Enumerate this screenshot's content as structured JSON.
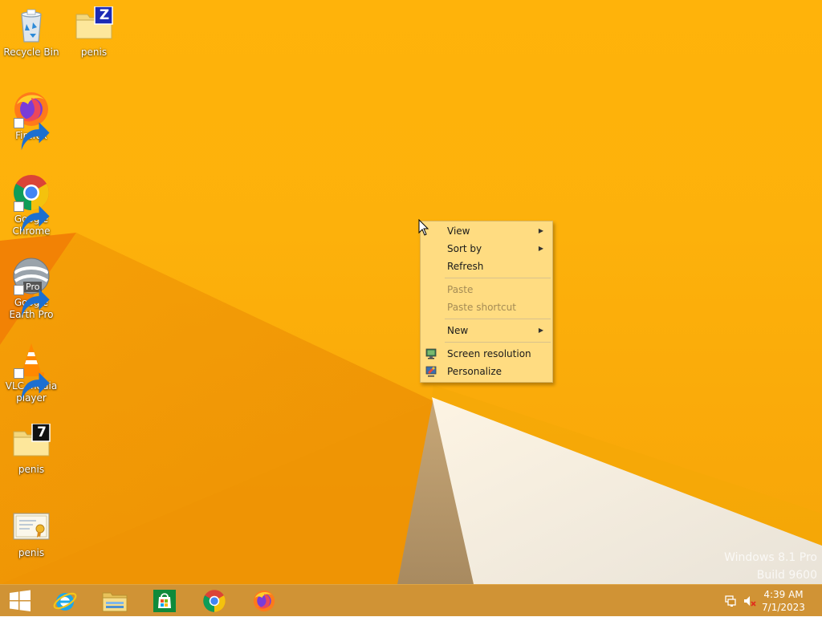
{
  "desktop": {
    "icons": [
      {
        "label": "Recycle Bin",
        "icon": "recycle-bin-icon"
      },
      {
        "label": "penis",
        "icon": "zip-folder-icon",
        "badge": "Z"
      },
      {
        "label": "Firefox",
        "icon": "firefox-icon"
      },
      {
        "label": "Google Chrome",
        "icon": "chrome-icon"
      },
      {
        "label": "Google Earth Pro",
        "icon": "google-earth-icon",
        "badge": "Pro"
      },
      {
        "label": "VLC media player",
        "icon": "vlc-icon"
      },
      {
        "label": "penis",
        "icon": "7z-folder-icon",
        "badge": "7"
      },
      {
        "label": "penis",
        "icon": "certificate-icon"
      }
    ]
  },
  "context_menu": {
    "items": [
      {
        "label": "View",
        "has_submenu": true,
        "enabled": true
      },
      {
        "label": "Sort by",
        "has_submenu": true,
        "enabled": true
      },
      {
        "label": "Refresh",
        "has_submenu": false,
        "enabled": true
      },
      {
        "label": "Paste",
        "has_submenu": false,
        "enabled": false
      },
      {
        "label": "Paste shortcut",
        "has_submenu": false,
        "enabled": false
      },
      {
        "label": "New",
        "has_submenu": true,
        "enabled": true
      },
      {
        "label": "Screen resolution",
        "has_submenu": false,
        "enabled": true,
        "icon": "monitor-icon"
      },
      {
        "label": "Personalize",
        "has_submenu": false,
        "enabled": true,
        "icon": "personalize-icon"
      }
    ],
    "submenu_glyph": "▶"
  },
  "watermark": {
    "line1": "Windows 8.1 Pro",
    "line2": "Build 9600"
  },
  "taskbar": {
    "pinned": [
      {
        "name": "start-button",
        "icon": "windows-logo-icon"
      },
      {
        "name": "taskbar-internet-explorer",
        "icon": "internet-explorer-icon"
      },
      {
        "name": "taskbar-file-explorer",
        "icon": "file-explorer-icon"
      },
      {
        "name": "taskbar-store",
        "icon": "store-icon"
      },
      {
        "name": "taskbar-chrome",
        "icon": "chrome-icon"
      },
      {
        "name": "taskbar-firefox",
        "icon": "firefox-icon"
      }
    ],
    "tray": {
      "network_icon": "network-icon",
      "volume_icon": "volume-muted-icon",
      "time": "4:39 AM",
      "date": "7/1/2023"
    }
  },
  "colors": {
    "wallpaper": "#fdb10b",
    "menu_background": "#ffe08c",
    "taskbar": "#cd8c28"
  }
}
